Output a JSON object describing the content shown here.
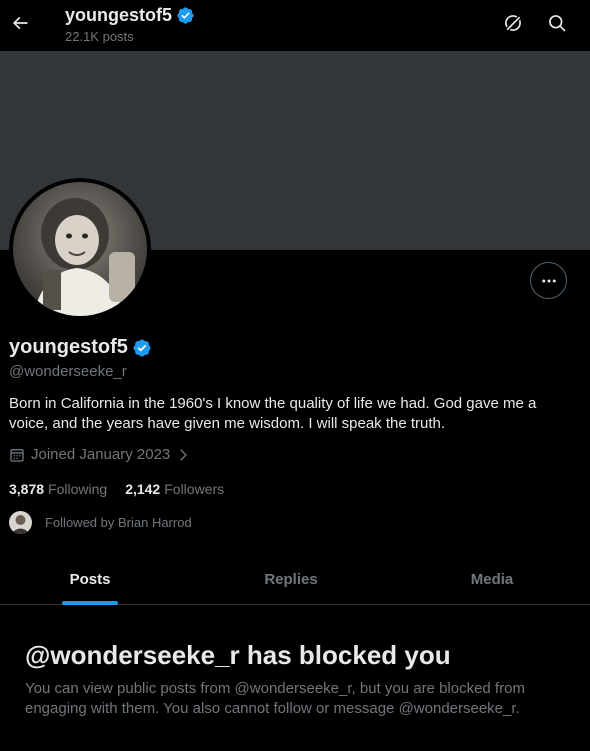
{
  "header": {
    "name": "youngestof5",
    "posts_count": "22.1K posts",
    "back_icon": "arrow-left-icon",
    "grok_icon": "grok-icon",
    "search_icon": "search-icon"
  },
  "profile": {
    "display_name": "youngestof5",
    "verified": true,
    "handle": "@wonderseeke_r",
    "bio": "Born in California in the 1960's I know the quality of life we had. God gave me a voice, and the years have given me wisdom.  I will speak the truth.",
    "joined": "Joined January 2023",
    "following_count": "3,878",
    "following_label": "Following",
    "followers_count": "2,142",
    "followers_label": "Followers",
    "followed_by": "Followed by Brian Harrod"
  },
  "tabs": [
    {
      "label": "Posts",
      "active": true
    },
    {
      "label": "Replies",
      "active": false
    },
    {
      "label": "Media",
      "active": false
    }
  ],
  "blocked": {
    "title": "@wonderseeke_r has blocked you",
    "message": "You can view public posts from @wonderseeke_r, but you are blocked from engaging with them. You also cannot follow or message @wonderseeke_r."
  },
  "colors": {
    "background": "#000000",
    "banner": "#333639",
    "accent": "#1d9bf0",
    "text_primary": "#e7e9ea",
    "text_secondary": "#71767b"
  }
}
